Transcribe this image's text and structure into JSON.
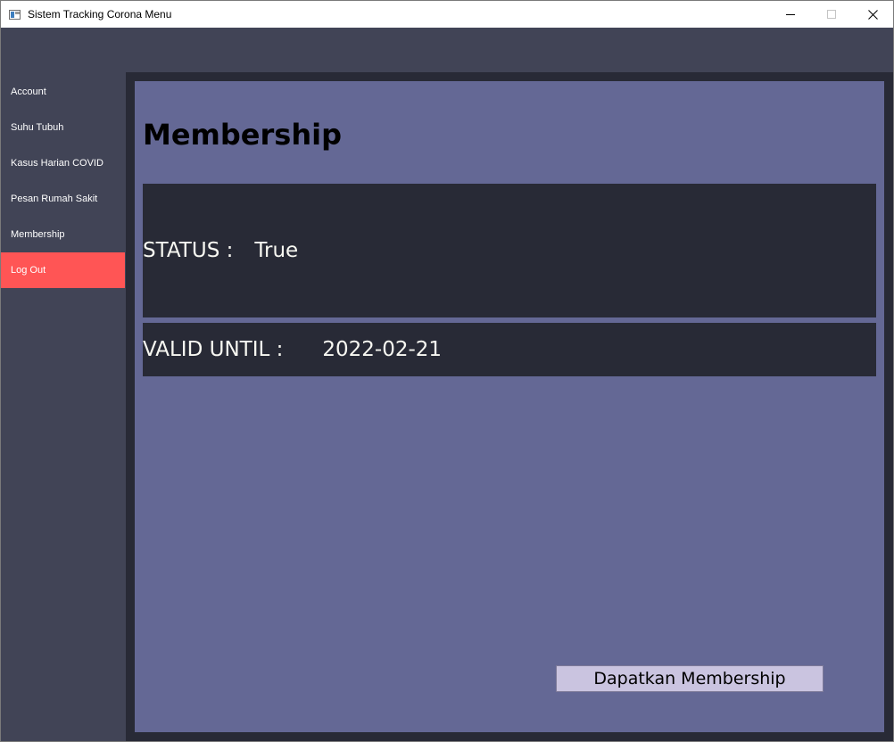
{
  "window": {
    "title": "Sistem Tracking Corona Menu",
    "controls": {
      "minimize_icon": "minimize-icon",
      "maximize_icon": "maximize-icon",
      "close_icon": "close-icon"
    }
  },
  "sidebar": {
    "items": [
      {
        "label": "Account"
      },
      {
        "label": "Suhu Tubuh"
      },
      {
        "label": "Kasus Harian COVID"
      },
      {
        "label": "Pesan Rumah Sakit"
      },
      {
        "label": "Membership"
      },
      {
        "label": "Log Out"
      }
    ]
  },
  "main": {
    "title": "Membership",
    "status": {
      "label": "STATUS :",
      "value": "True"
    },
    "valid_until": {
      "label": "VALID UNTIL :",
      "value": "2022-02-21"
    },
    "button_label": "Dapatkan Membership"
  },
  "colors": {
    "sidebar_bg": "#414456",
    "frame_bg": "#282a36",
    "panel_bg": "#646895",
    "logout_bg": "#ff5555",
    "button_bg": "#cac4e0",
    "value_text": "#f8f8f2"
  }
}
